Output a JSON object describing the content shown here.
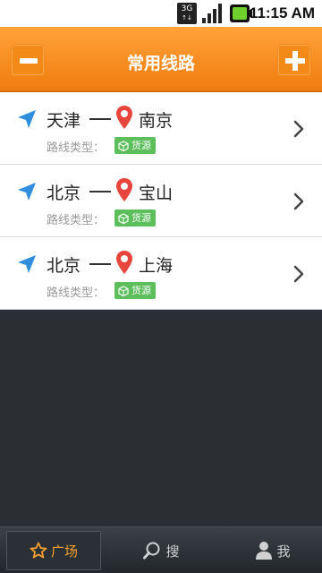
{
  "status_bar": {
    "network": "3G",
    "time": "11:15 AM"
  },
  "header": {
    "title": "常用线路",
    "left_button_icon": "minus-icon",
    "right_button_icon": "plus-icon"
  },
  "routes": [
    {
      "from": "天津",
      "to": "南京",
      "type_label": "路线类型：",
      "type": "货源"
    },
    {
      "from": "北京",
      "to": "宝山",
      "type_label": "路线类型：",
      "type": "货源"
    },
    {
      "from": "北京",
      "to": "上海",
      "type_label": "路线类型：",
      "type": "货源"
    }
  ],
  "tabs": [
    {
      "label": "广场",
      "icon": "star-icon",
      "active": true
    },
    {
      "label": "搜",
      "icon": "search-icon",
      "active": false
    },
    {
      "label": "我",
      "icon": "user-icon",
      "active": false
    }
  ],
  "colors": {
    "header": "#f08a1c",
    "tag": "#5cbf5b",
    "nav_arrow": "#2f8fdc",
    "pin": "#e8453c",
    "active_tab": "#f5a030"
  }
}
